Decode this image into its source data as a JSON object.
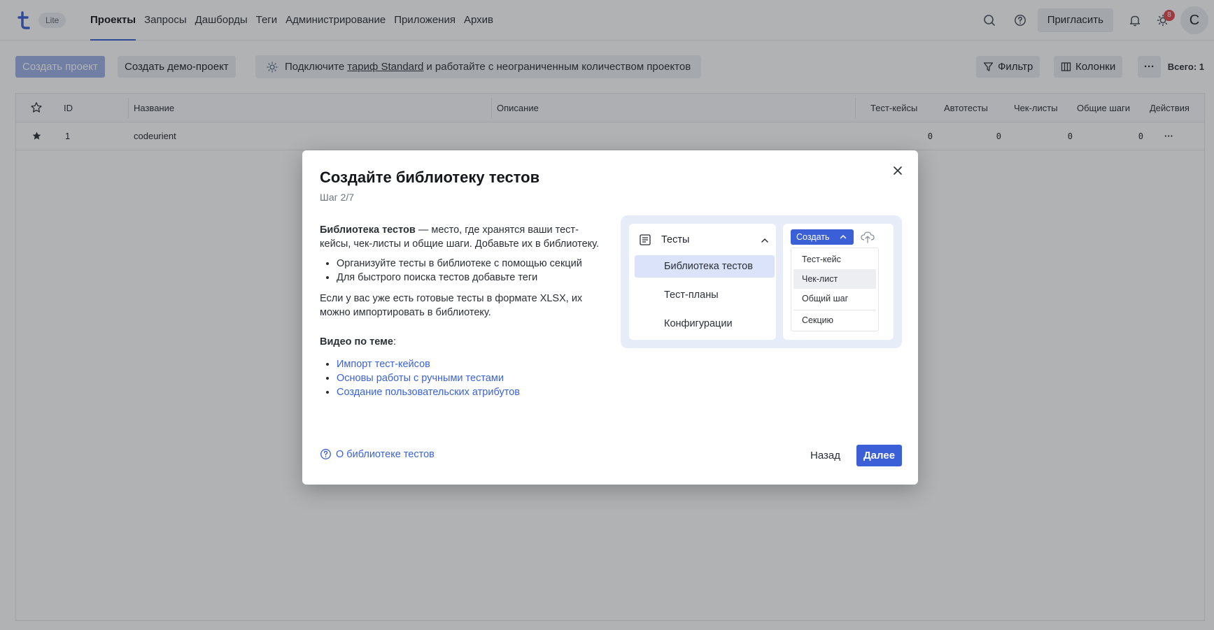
{
  "app": {
    "badge": "Lite"
  },
  "nav": {
    "items": [
      {
        "label": "Проекты",
        "active": true
      },
      {
        "label": "Запросы"
      },
      {
        "label": "Дашборды"
      },
      {
        "label": "Теги"
      },
      {
        "label": "Администрирование"
      },
      {
        "label": "Приложения"
      },
      {
        "label": "Архив"
      }
    ],
    "invite_label": "Пригласить",
    "notif_badge": "8",
    "avatar_letter": "С"
  },
  "toolbar": {
    "create_project": "Создать проект",
    "create_demo": "Создать демо-проект",
    "promo_before": "Подключите",
    "promo_link": "тариф Standard",
    "promo_after": "и работайте с неограниченным количеством проектов",
    "filter": "Фильтр",
    "columns": "Колонки",
    "more": "···",
    "total": "Всего: 1"
  },
  "table": {
    "headers": {
      "id": "ID",
      "name": "Название",
      "description": "Описание",
      "testcases": "Тест-кейсы",
      "autotests": "Автотесты",
      "checklists": "Чек-листы",
      "shared_steps": "Общие шаги",
      "actions": "Действия"
    },
    "rows": [
      {
        "id": "1",
        "name": "codeurient",
        "description": "",
        "testcases": "0",
        "autotests": "0",
        "checklists": "0",
        "shared_steps": "0",
        "actions": "···"
      }
    ]
  },
  "modal": {
    "title": "Создайте библиотеку тестов",
    "step": "Шаг 2/7",
    "intro_bold": "Библиотека тестов",
    "intro_rest": " — место, где хранятся ваши тест-кейсы, чек-листы и общие шаги. Добавьте их в библиотеку.",
    "bullets": [
      "Организуйте тесты в библиотеке с помощью секций",
      "Для быстрого поиска тестов добавьте теги"
    ],
    "import_text": "Если у вас уже есть готовые тесты в формате XLSX, их можно импортировать в библиотеку.",
    "videos_title": "Видео по теме",
    "videos_colon": ":",
    "videos": [
      "Импорт тест-кейсов",
      "Основы работы с ручными тестами",
      "Создание пользовательских атрибутов"
    ],
    "help_link": "О библиотеке тестов",
    "back": "Назад",
    "next": "Далее",
    "illustration": {
      "section_title": "Тесты",
      "items": [
        "Библиотека тестов",
        "Тест-планы",
        "Конфигурации"
      ],
      "create_label": "Создать",
      "menu": [
        "Тест-кейс",
        "Чек-лист",
        "Общий шаг",
        "Секцию"
      ]
    }
  },
  "colors": {
    "accent": "#3a5fd6",
    "link": "#3a62d7",
    "badge": "#e5484d"
  }
}
